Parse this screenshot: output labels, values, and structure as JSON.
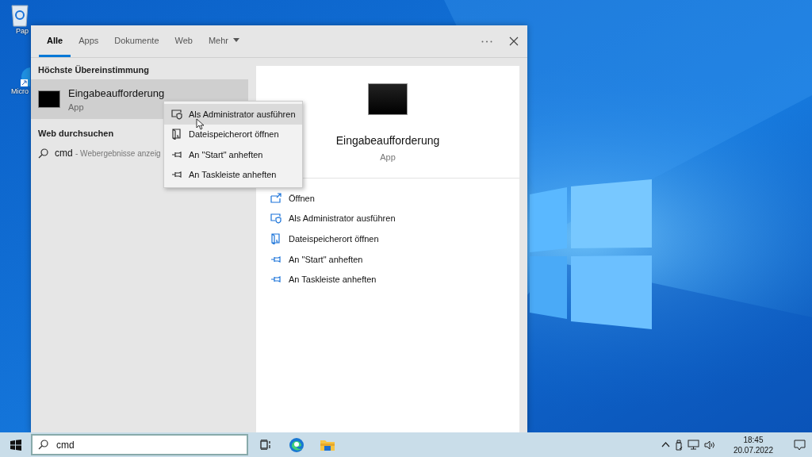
{
  "desktop": {
    "icons": [
      {
        "label": "Pap",
        "kind": "recycle"
      },
      {
        "label": "Micro",
        "kind": "edge"
      }
    ]
  },
  "search_panel": {
    "tabs": [
      {
        "label": "Alle",
        "selected": true
      },
      {
        "label": "Apps",
        "selected": false
      },
      {
        "label": "Dokumente",
        "selected": false
      },
      {
        "label": "Web",
        "selected": false
      },
      {
        "label": "Mehr",
        "selected": false,
        "kind": "dropdown"
      }
    ],
    "best_match_heading": "Höchste Übereinstimmung",
    "best_match": {
      "title": "Eingabeaufforderung",
      "subtitle": "App",
      "selected": true
    },
    "web_heading": "Web durchsuchen",
    "web_result": {
      "query": "cmd",
      "hint": "- Webergebnisse anzeig"
    },
    "preview": {
      "title": "Eingabeaufforderung",
      "subtitle": "App",
      "actions": [
        {
          "label": "Öffnen",
          "kind": "open"
        },
        {
          "label": "Als Administrator ausführen",
          "kind": "admin"
        },
        {
          "label": "Dateispeicherort öffnen",
          "kind": "location"
        },
        {
          "label": "An \"Start\" anheften",
          "kind": "pin"
        },
        {
          "label": "An Taskleiste anheften",
          "kind": "pin"
        }
      ]
    }
  },
  "context_menu": {
    "items": [
      {
        "label": "Als Administrator ausführen",
        "kind": "admin",
        "selected": true
      },
      {
        "label": "Dateispeicherort öffnen",
        "kind": "location",
        "selected": false
      },
      {
        "label": "An \"Start\" anheften",
        "kind": "pin",
        "selected": false
      },
      {
        "label": "An Taskleiste anheften",
        "kind": "pin",
        "selected": false
      }
    ]
  },
  "taskbar": {
    "search": {
      "value": "cmd"
    },
    "clock": {
      "time": "18:45",
      "date": "20.07.2022"
    }
  }
}
